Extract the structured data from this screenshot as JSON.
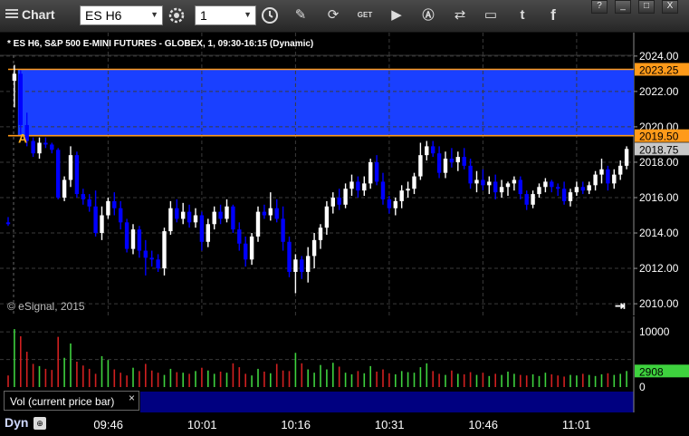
{
  "window": {
    "title": "Chart"
  },
  "toolbar": {
    "symbol_value": "ES H6",
    "interval_value": "1",
    "icons": [
      "settings-icon",
      "clock-icon",
      "pencil-icon",
      "refresh-icon",
      "get-icon",
      "play-icon",
      "alert-icon",
      "link-icon",
      "comment-icon",
      "twitter-icon",
      "facebook-icon"
    ],
    "window_buttons": [
      "?",
      "_",
      "□",
      "X"
    ]
  },
  "chart_header": "* ES H6, S&P 500 E-MINI FUTURES - GLOBEX, 1, 09:30-16:15 (Dynamic)",
  "watermark": "© eSignal, 2015",
  "annotation_label": "A",
  "volume_panel": {
    "label": "Vol (current price bar)",
    "close_label": "×",
    "last_volume": "2908"
  },
  "footer": {
    "mode": "Dyn",
    "lock_glyph": "⊕"
  },
  "colors": {
    "up": "#ffffff",
    "down": "#0000ff",
    "zone": "#1a40ff",
    "level_line": "#ff9a1a",
    "vol_up": "#3ed23e",
    "vol_down": "#d22020",
    "panel_bg": "#000080"
  },
  "chart_data": [
    {
      "type": "candlestick",
      "y_ticks": [
        "2024.00",
        "2022.00",
        "2020.00",
        "2018.00",
        "2016.00",
        "2014.00",
        "2012.00",
        "2010.00"
      ],
      "ylim": [
        2009.8,
        2024.3
      ],
      "x_ticks": [
        "09:46",
        "10:01",
        "10:16",
        "10:31",
        "10:46",
        "11:01"
      ],
      "x_tick_bar_index": [
        16,
        31,
        46,
        61,
        76,
        91
      ],
      "grid": true,
      "price_labels": [
        {
          "value": 2023.25,
          "label": "2023.25",
          "color": "#ff9a1a"
        },
        {
          "value": 2019.5,
          "label": "2019.50",
          "color": "#ff9a1a"
        },
        {
          "value": 2018.75,
          "label": "2018.75",
          "color": "#c8c8c8"
        }
      ],
      "zone": {
        "from": 2019.5,
        "to": 2023.25,
        "color": "#1a40ff"
      },
      "ohlc": [
        [
          2014.6,
          2014.9,
          2014.4,
          2014.5
        ],
        [
          2022.6,
          2023.5,
          2021.1,
          2023.0
        ],
        [
          2023.0,
          2023.2,
          2019.6,
          2020.1
        ],
        [
          2020.1,
          2020.8,
          2018.9,
          2019.2
        ],
        [
          2019.2,
          2019.4,
          2018.3,
          2018.5
        ],
        [
          2018.5,
          2019.4,
          2018.2,
          2019.1
        ],
        [
          2019.1,
          2019.4,
          2018.8,
          2019.0
        ],
        [
          2019.0,
          2019.1,
          2018.5,
          2018.7
        ],
        [
          2018.7,
          2018.8,
          2015.9,
          2016.0
        ],
        [
          2016.0,
          2017.2,
          2015.8,
          2017.0
        ],
        [
          2017.0,
          2018.9,
          2016.6,
          2018.4
        ],
        [
          2018.4,
          2018.6,
          2016.0,
          2016.2
        ],
        [
          2016.2,
          2016.5,
          2015.6,
          2015.9
        ],
        [
          2015.9,
          2016.2,
          2015.2,
          2015.5
        ],
        [
          2015.5,
          2016.4,
          2013.8,
          2014.0
        ],
        [
          2014.0,
          2015.5,
          2013.6,
          2015.0
        ],
        [
          2015.0,
          2016.0,
          2014.8,
          2015.8
        ],
        [
          2015.8,
          2016.3,
          2015.0,
          2015.4
        ],
        [
          2015.4,
          2015.8,
          2014.2,
          2014.6
        ],
        [
          2014.6,
          2014.8,
          2012.9,
          2013.1
        ],
        [
          2013.1,
          2014.5,
          2012.8,
          2014.2
        ],
        [
          2014.2,
          2014.4,
          2012.6,
          2013.0
        ],
        [
          2013.0,
          2013.6,
          2011.6,
          2012.6
        ],
        [
          2012.6,
          2013.0,
          2012.1,
          2012.5
        ],
        [
          2012.5,
          2012.8,
          2011.8,
          2012.0
        ],
        [
          2012.0,
          2014.3,
          2011.6,
          2014.1
        ],
        [
          2014.1,
          2015.8,
          2013.9,
          2015.4
        ],
        [
          2015.4,
          2015.9,
          2014.6,
          2014.8
        ],
        [
          2014.8,
          2015.7,
          2014.5,
          2015.2
        ],
        [
          2015.2,
          2015.6,
          2014.3,
          2014.6
        ],
        [
          2014.6,
          2015.4,
          2014.3,
          2015.0
        ],
        [
          2015.0,
          2015.2,
          2013.0,
          2013.5
        ],
        [
          2013.5,
          2014.8,
          2013.2,
          2014.5
        ],
        [
          2014.5,
          2015.5,
          2014.2,
          2015.2
        ],
        [
          2015.2,
          2015.6,
          2014.5,
          2014.8
        ],
        [
          2014.8,
          2015.9,
          2014.6,
          2015.5
        ],
        [
          2015.5,
          2015.6,
          2014.0,
          2014.2
        ],
        [
          2014.2,
          2014.6,
          2013.0,
          2013.4
        ],
        [
          2013.4,
          2013.8,
          2012.1,
          2012.5
        ],
        [
          2012.5,
          2014.0,
          2012.2,
          2013.8
        ],
        [
          2013.8,
          2015.5,
          2013.5,
          2015.2
        ],
        [
          2015.2,
          2015.6,
          2014.8,
          2015.0
        ],
        [
          2015.0,
          2016.3,
          2014.7,
          2015.4
        ],
        [
          2015.4,
          2015.9,
          2014.6,
          2014.8
        ],
        [
          2014.8,
          2015.5,
          2013.0,
          2013.5
        ],
        [
          2013.5,
          2013.8,
          2011.5,
          2011.8
        ],
        [
          2011.8,
          2012.8,
          2010.6,
          2012.5
        ],
        [
          2012.5,
          2012.7,
          2011.4,
          2011.8
        ],
        [
          2011.8,
          2013.2,
          2011.2,
          2012.7
        ],
        [
          2012.7,
          2014.0,
          2012.0,
          2013.6
        ],
        [
          2013.6,
          2014.5,
          2013.1,
          2014.3
        ],
        [
          2014.3,
          2015.8,
          2013.9,
          2015.5
        ],
        [
          2015.5,
          2016.3,
          2015.1,
          2016.0
        ],
        [
          2016.0,
          2016.5,
          2015.3,
          2015.6
        ],
        [
          2015.6,
          2016.8,
          2015.4,
          2016.5
        ],
        [
          2016.5,
          2017.3,
          2016.1,
          2016.9
        ],
        [
          2016.9,
          2017.2,
          2016.0,
          2016.4
        ],
        [
          2016.4,
          2017.2,
          2016.1,
          2016.8
        ],
        [
          2016.8,
          2018.2,
          2016.5,
          2018.0
        ],
        [
          2018.0,
          2018.4,
          2016.7,
          2016.9
        ],
        [
          2016.9,
          2017.4,
          2015.6,
          2015.9
        ],
        [
          2015.9,
          2016.1,
          2015.1,
          2015.4
        ],
        [
          2015.4,
          2016.0,
          2015.0,
          2015.8
        ],
        [
          2015.8,
          2016.7,
          2015.4,
          2016.4
        ],
        [
          2016.4,
          2016.9,
          2016.0,
          2016.5
        ],
        [
          2016.5,
          2017.4,
          2016.2,
          2017.2
        ],
        [
          2017.2,
          2019.1,
          2017.0,
          2018.4
        ],
        [
          2018.4,
          2019.2,
          2018.1,
          2018.9
        ],
        [
          2018.9,
          2019.2,
          2018.3,
          2018.5
        ],
        [
          2018.5,
          2018.9,
          2017.1,
          2017.4
        ],
        [
          2017.4,
          2018.6,
          2017.1,
          2018.2
        ],
        [
          2018.2,
          2018.8,
          2017.7,
          2018.0
        ],
        [
          2018.0,
          2018.6,
          2017.5,
          2018.3
        ],
        [
          2018.3,
          2018.8,
          2017.6,
          2017.8
        ],
        [
          2017.8,
          2018.2,
          2016.5,
          2016.8
        ],
        [
          2016.8,
          2017.5,
          2016.3,
          2017.0
        ],
        [
          2017.0,
          2017.6,
          2016.4,
          2016.7
        ],
        [
          2016.7,
          2017.2,
          2016.2,
          2016.9
        ],
        [
          2016.9,
          2017.3,
          2015.9,
          2016.3
        ],
        [
          2016.3,
          2017.0,
          2016.0,
          2016.6
        ],
        [
          2016.6,
          2016.9,
          2016.1,
          2016.8
        ],
        [
          2016.8,
          2017.2,
          2016.4,
          2017.0
        ],
        [
          2017.0,
          2017.2,
          2015.9,
          2016.2
        ],
        [
          2016.2,
          2016.4,
          2015.3,
          2015.6
        ],
        [
          2015.6,
          2016.4,
          2015.4,
          2016.2
        ],
        [
          2016.2,
          2016.8,
          2016.0,
          2016.6
        ],
        [
          2016.6,
          2017.1,
          2016.3,
          2016.9
        ],
        [
          2016.9,
          2017.0,
          2016.3,
          2016.6
        ],
        [
          2016.6,
          2016.8,
          2016.1,
          2016.5
        ],
        [
          2016.5,
          2016.9,
          2015.6,
          2015.8
        ],
        [
          2015.8,
          2016.5,
          2015.5,
          2016.3
        ],
        [
          2016.3,
          2016.9,
          2016.1,
          2016.6
        ],
        [
          2016.6,
          2016.9,
          2016.2,
          2016.4
        ],
        [
          2016.4,
          2016.9,
          2016.2,
          2016.7
        ],
        [
          2016.7,
          2017.5,
          2016.4,
          2017.3
        ],
        [
          2017.3,
          2018.2,
          2016.8,
          2017.6
        ],
        [
          2017.6,
          2017.8,
          2016.4,
          2016.8
        ],
        [
          2016.8,
          2017.6,
          2016.5,
          2017.3
        ],
        [
          2017.3,
          2018.1,
          2017.0,
          2017.8
        ],
        [
          2017.8,
          2018.9,
          2017.6,
          2018.75
        ]
      ]
    },
    {
      "type": "bar",
      "name": "Vol (current price bar)",
      "y_ticks": [
        "10000",
        "5000",
        "0"
      ],
      "ylim": [
        0,
        11500
      ],
      "last_value": 2908,
      "values": [
        2100,
        10500,
        9200,
        6400,
        4200,
        3800,
        3300,
        3100,
        9100,
        5300,
        7900,
        4600,
        3900,
        3300,
        2400,
        5600,
        4900,
        3200,
        2600,
        2100,
        3500,
        2900,
        4200,
        3000,
        2600,
        2200,
        3300,
        2700,
        2600,
        2400,
        2900,
        3500,
        3000,
        2400,
        2800,
        2600,
        4300,
        3600,
        2400,
        2100,
        3300,
        2800,
        2500,
        4200,
        3000,
        2900,
        6200,
        4300,
        3200,
        2600,
        4000,
        3200,
        4400,
        3700,
        2600,
        2300,
        2900,
        2500,
        3800,
        2800,
        3200,
        2500,
        2300,
        2900,
        2700,
        2600,
        3600,
        4300,
        2900,
        2400,
        2200,
        3000,
        2400,
        2300,
        2700,
        2200,
        2600,
        2000,
        2400,
        2200,
        2800,
        2400,
        2200,
        2100,
        2300,
        2000,
        2600,
        2300,
        2100,
        1900,
        2200,
        2100,
        2400,
        2200,
        2000,
        2300,
        2500,
        2200,
        2400,
        2908
      ]
    }
  ]
}
